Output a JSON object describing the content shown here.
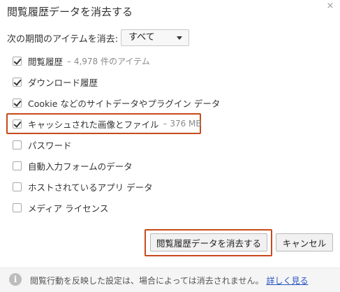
{
  "dialog": {
    "title": "閲覧履歴データを消去する",
    "close_glyph": "×"
  },
  "range": {
    "label": "次の期間のアイテムを消去:",
    "selected": "すべて"
  },
  "options": [
    {
      "label": "閲覧履歴",
      "detail": "– 4,978 件のアイテム",
      "checked": true
    },
    {
      "label": "ダウンロード履歴",
      "detail": "",
      "checked": true
    },
    {
      "label": "Cookie などのサイトデータやプラグイン データ",
      "detail": "",
      "checked": true
    },
    {
      "label": "キャッシュされた画像とファイル",
      "detail": "– 376 MB",
      "checked": true
    },
    {
      "label": "パスワード",
      "detail": "",
      "checked": false
    },
    {
      "label": "自動入力フォームのデータ",
      "detail": "",
      "checked": false
    },
    {
      "label": "ホストされているアプリ データ",
      "detail": "",
      "checked": false
    },
    {
      "label": "メディア ライセンス",
      "detail": "",
      "checked": false
    }
  ],
  "buttons": {
    "clear": "閲覧履歴データを消去する",
    "cancel": "キャンセル"
  },
  "footer": {
    "icon": "info-icon",
    "text": "閲覧行動を反映した設定は、場合によっては消去されません。",
    "link": "詳しく見る"
  },
  "colors": {
    "highlight": "#c84a1c",
    "link": "#2a55c4"
  }
}
